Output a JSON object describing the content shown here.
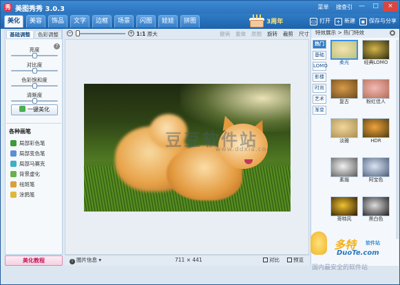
{
  "window": {
    "title": "美图秀秀 3.0.3",
    "menu_links": [
      "菜单",
      "搜查引"
    ],
    "min_label": "—",
    "max_label": "□",
    "close_label": "×"
  },
  "tabs": [
    "美化",
    "美容",
    "饰品",
    "文字",
    "边框",
    "场景",
    "闪图",
    "娃娃",
    "拼图"
  ],
  "anniversary_label": "3周年",
  "toolbar": {
    "open": "打开",
    "new": "新建",
    "save_share": "保存与分享"
  },
  "left_panel": {
    "subtabs": [
      "基础调整",
      "色彩调整"
    ],
    "help_glyph": "?",
    "sliders": [
      {
        "label": "亮度",
        "level": 0.5
      },
      {
        "label": "对比度",
        "level": 0.5
      },
      {
        "label": "色彩饱和度",
        "level": 0.5
      },
      {
        "label": "清晰度",
        "level": 0.5
      }
    ],
    "onekey_label": "一键美化",
    "brushes_title": "各种画笔",
    "brushes": [
      "局部彩色笔",
      "局部变色笔",
      "局部马赛克",
      "背景虚化",
      "祛斑笔",
      "涂鸦笔"
    ],
    "brush_colors": [
      "#3c9b3c",
      "#5a8fd4",
      "#3fb0c8",
      "#6ab04c",
      "#d9a03b",
      "#e0b83a"
    ],
    "tutorial_label": "美化教程"
  },
  "center_toolbar": {
    "zoom_out_glyph": "−",
    "zoom_in_glyph": "+",
    "ratio_prefix": "1:1",
    "ratio_label": "原大",
    "actions_disabled": [
      "撤销",
      "重做",
      "原图"
    ],
    "actions_enabled": [
      "旋转",
      "裁剪",
      "尺寸"
    ]
  },
  "photo": {
    "watermark": "豆豆软件站",
    "watermark_url": "www.ddxia.com"
  },
  "statusbar": {
    "image_info": "图片信息",
    "image_size": "711 × 441",
    "compare": "对比",
    "preview": "预览"
  },
  "overlay_watermark": {
    "brand": "多特",
    "brand_small": "软件站",
    "url": "DuoTe.com",
    "slogan": "国内最安全的软件站"
  },
  "right_panel": {
    "header": "特效展示 > 热门特效",
    "categories": [
      "热门",
      "基础",
      "LOMO",
      "影楼",
      "时尚",
      "艺术",
      "渐变"
    ],
    "effects": [
      {
        "label": "柔光",
        "gradient": [
          "#f3e3b0",
          "#b9c27a"
        ],
        "active": true
      },
      {
        "label": "经典LOMO",
        "gradient": [
          "#d5b54a",
          "#2a2a10"
        ],
        "active": false
      },
      {
        "label": "复古",
        "gradient": [
          "#d89a48",
          "#6a4a1e"
        ],
        "active": false
      },
      {
        "label": "粉红佳人",
        "gradient": [
          "#f2b9b4",
          "#b36b55"
        ],
        "active": false
      },
      {
        "label": "淡雅",
        "gradient": [
          "#f2d79c",
          "#a98e52"
        ],
        "active": false
      },
      {
        "label": "HDR",
        "gradient": [
          "#f0a23a",
          "#4a3c10"
        ],
        "active": false
      },
      {
        "label": "素描",
        "gradient": [
          "#f1f1f1",
          "#5a5a5a"
        ],
        "active": false
      },
      {
        "label": "阿宝色",
        "gradient": [
          "#d9e3f3",
          "#4c5d7a"
        ],
        "active": false
      },
      {
        "label": "哥特风",
        "gradient": [
          "#f0c230",
          "#2b1a05"
        ],
        "active": false
      },
      {
        "label": "黑白色",
        "gradient": [
          "#dcdcdc",
          "#1e1e1e"
        ],
        "active": false
      }
    ]
  }
}
